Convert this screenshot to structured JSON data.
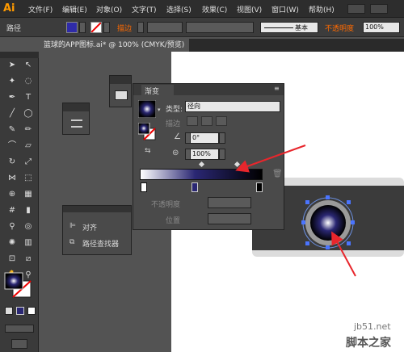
{
  "app": {
    "logo": "Ai"
  },
  "menu": [
    "文件(F)",
    "编辑(E)",
    "对象(O)",
    "文字(T)",
    "选择(S)",
    "效果(C)",
    "视图(V)",
    "窗口(W)",
    "帮助(H)"
  ],
  "control_bar": {
    "selection_label": "路径",
    "stroke_label": "描边",
    "stroke_profile": "基本",
    "opacity_label": "不透明度",
    "opacity_value": "100%"
  },
  "document": {
    "tab_title": "篮球的APP图标.ai* @ 100% (CMYK/预览)"
  },
  "gradient_panel": {
    "title": "渐变",
    "type_label": "类型:",
    "type_value": "径向",
    "stroke_label": "描边",
    "angle_value": "0°",
    "aspect_value": "100%",
    "opacity_label": "不透明度",
    "location_label": "位置"
  },
  "align_panel": {
    "items": [
      "对齐",
      "路径查找器"
    ]
  },
  "watermark": {
    "site": "jb51.net",
    "brand": "脚本之家"
  },
  "colors": {
    "accent_orange": "#ff9a00",
    "gradient_mid": "#2a2773",
    "arrow_red": "#e8262c",
    "warn_orange": "#ff6a00"
  }
}
